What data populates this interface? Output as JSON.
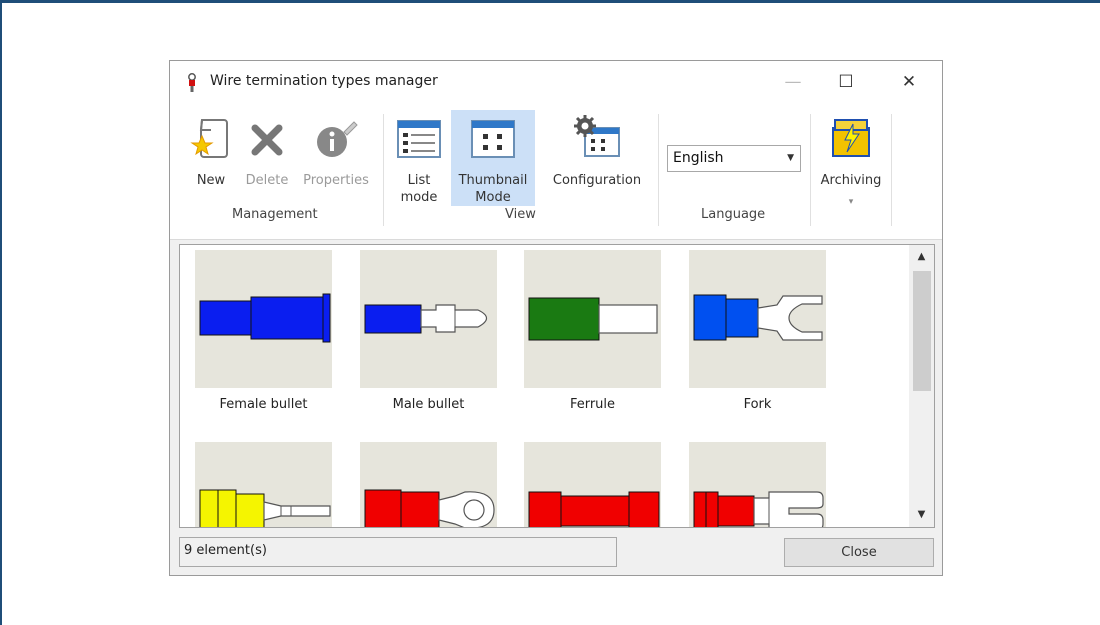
{
  "window": {
    "title": "Wire termination types manager",
    "minimize_glyph": "—",
    "maximize_glyph": "☐",
    "close_glyph": "✕"
  },
  "ribbon": {
    "management": {
      "label": "Management",
      "new_label": "New",
      "delete_label": "Delete",
      "properties_label": "Properties"
    },
    "view": {
      "label": "View",
      "list_mode_line1": "List",
      "list_mode_line2": "mode",
      "thumbnail_line1": "Thumbnail",
      "thumbnail_line2": "Mode",
      "configuration_label": "Configuration"
    },
    "language": {
      "label": "Language",
      "selected": "English"
    },
    "archiving": {
      "label": "Archiving"
    }
  },
  "thumbnails": [
    {
      "label": "Female bullet",
      "color": "#0a1ef0"
    },
    {
      "label": "Male bullet",
      "color": "#0a1ef0"
    },
    {
      "label": "Ferrule",
      "color": "#1a7a12"
    },
    {
      "label": "Fork",
      "color": "#0050f0"
    },
    {
      "label": "",
      "color": "#f5f500"
    },
    {
      "label": "",
      "color": "#f00000"
    },
    {
      "label": "",
      "color": "#f00000"
    },
    {
      "label": "",
      "color": "#f00000"
    }
  ],
  "status": {
    "count_text": "9 element(s)",
    "close_label": "Close"
  }
}
